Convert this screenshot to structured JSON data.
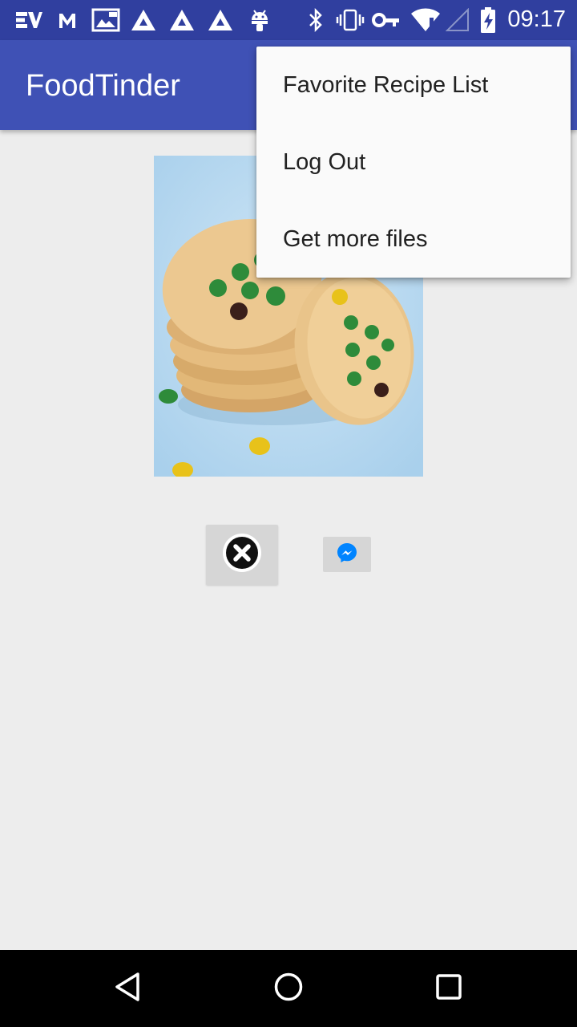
{
  "status_bar": {
    "time": "09:17",
    "icons": [
      "vpn-express-icon",
      "gmail-icon",
      "photo-notification-icon",
      "triangle-app-icon",
      "triangle-app-icon",
      "triangle-app-icon",
      "android-icon",
      "bluetooth-icon",
      "vibrate-icon",
      "key-icon",
      "wifi-icon",
      "no-signal-icon",
      "battery-charging-icon"
    ]
  },
  "app_bar": {
    "title": "FoodTinder"
  },
  "overflow_menu": {
    "items": [
      {
        "label": "Favorite Recipe List"
      },
      {
        "label": "Log Out"
      },
      {
        "label": "Get more files"
      }
    ]
  },
  "content": {
    "image_icon": "cookie-photo",
    "dislike_icon": "close-circle-icon",
    "share_icon": "messenger-icon"
  },
  "colors": {
    "primary": "#3f51b5",
    "primary_dark": "#303f9f",
    "background": "#ededed",
    "messenger": "#0084ff"
  },
  "nav_bar": {
    "icons": [
      "back-icon",
      "home-icon",
      "recents-icon"
    ]
  }
}
